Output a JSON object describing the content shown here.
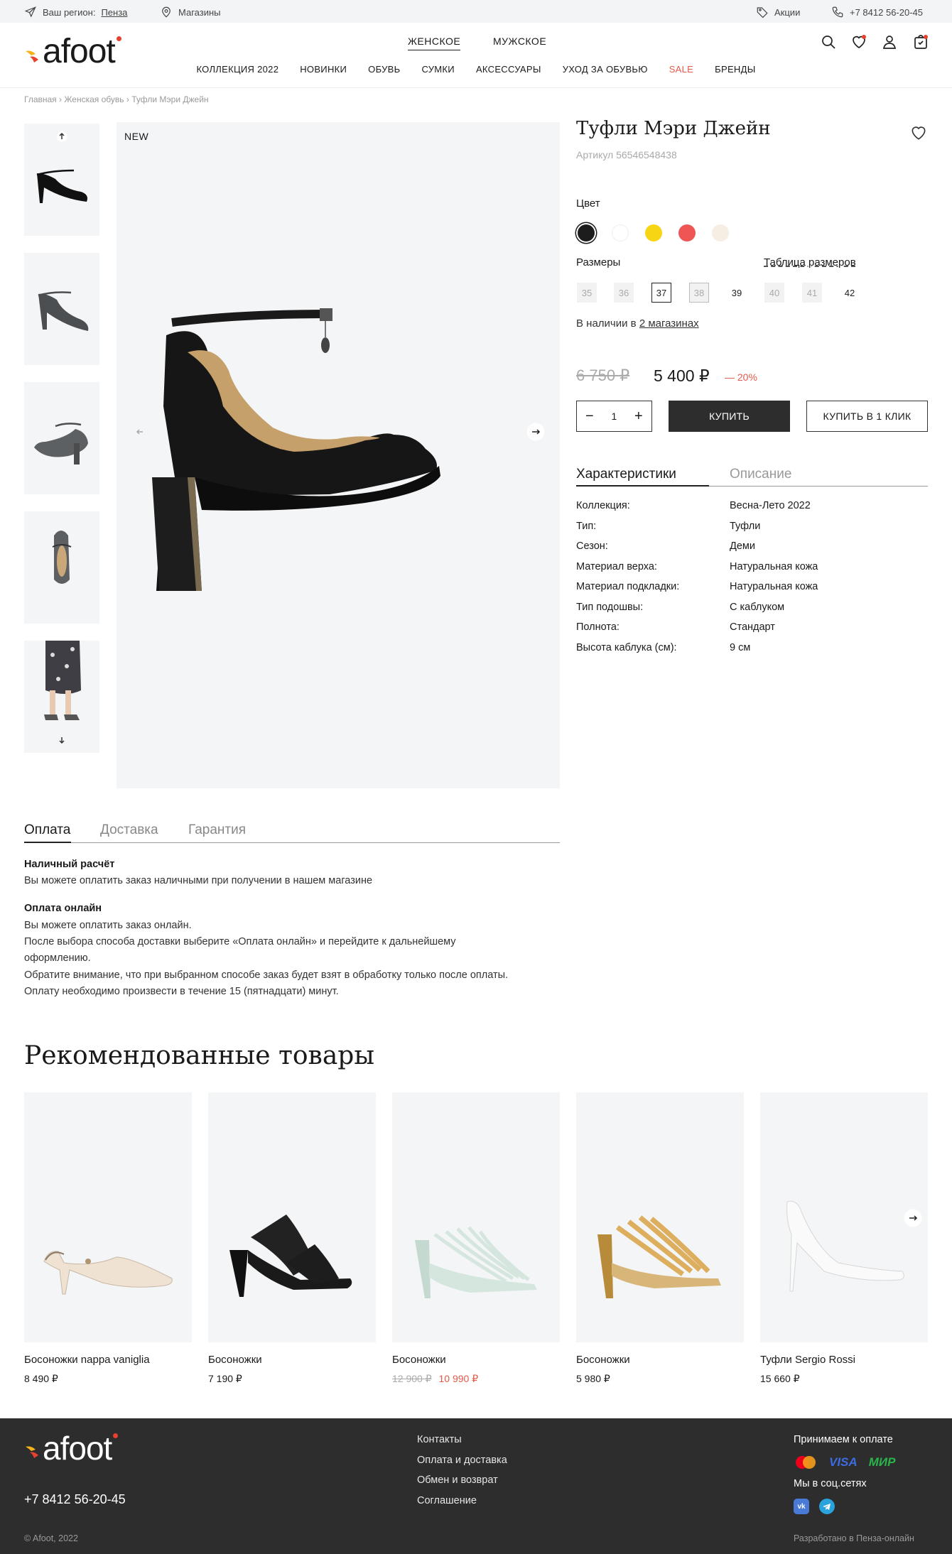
{
  "topbar": {
    "region_label": "Ваш регион:",
    "region_value": "Пенза",
    "stores": "Магазины",
    "promos": "Акции",
    "phone": "+7 8412 56-20-45"
  },
  "header": {
    "logo_text": "afoot",
    "genders": [
      "ЖЕНСКОЕ",
      "МУЖСКОЕ"
    ],
    "menu": [
      "КОЛЛЕКЦИЯ 2022",
      "НОВИНКИ",
      "ОБУВЬ",
      "СУМКИ",
      "АКСЕССУАРЫ",
      "УХОД ЗА ОБУВЬЮ",
      "SALE",
      "БРЕНДЫ"
    ],
    "sale_color": "#e35a4a"
  },
  "breadcrumbs": [
    "Главная",
    "Женская обувь",
    "Туфли Мэри Джейн"
  ],
  "gallery": {
    "badge": "NEW"
  },
  "product": {
    "title": "Туфли Мэри Джейн",
    "sku": "Артикул 56546548438",
    "color_label": "Цвет",
    "colors": [
      "#1d1d1d",
      "#ffffff",
      "#f7d514",
      "#f05555",
      "#f7eee3"
    ],
    "sizes_label": "Размеры",
    "size_table": "Таблица размеров",
    "sizes": [
      "35",
      "36",
      "37",
      "38",
      "39",
      "40",
      "41",
      "42"
    ],
    "availability_prefix": "В наличии в",
    "availability_link": "2 магазинах",
    "old_price": "6 750 ₽",
    "price": "5 400 ₽",
    "discount": "— 20%",
    "qty": "1",
    "buy": "КУПИТЬ",
    "buy_one_click": "КУПИТЬ В 1 КЛИК",
    "tabs": [
      "Характеристики",
      "Описание"
    ],
    "specs": [
      {
        "k": "Коллекция:",
        "v": "Весна-Лето 2022"
      },
      {
        "k": "Тип:",
        "v": "Туфли"
      },
      {
        "k": "Сезон:",
        "v": "Деми"
      },
      {
        "k": "Материал верха:",
        "v": "Натуральная кожа"
      },
      {
        "k": "Материал подкладки:",
        "v": "Натуральная кожа"
      },
      {
        "k": "Тип подошвы:",
        "v": "С каблуком"
      },
      {
        "k": "Полнота:",
        "v": "Стандарт"
      },
      {
        "k": "Высота каблука (см):",
        "v": "9 см"
      }
    ]
  },
  "payment": {
    "tabs": [
      "Оплата",
      "Доставка",
      "Гарантия"
    ],
    "cash_title": "Наличный расчёт",
    "cash_text": "Вы можете оплатить заказ наличными при получении в нашем магазине",
    "online_title": "Оплата онлайн",
    "online_lines": [
      "Вы можете оплатить заказ онлайн.",
      "После выбора способа доставки выберите «Оплата онлайн» и перейдите к дальнейшему",
      "оформлению.",
      "Обратите внимание, что при выбранном способе заказ будет взят в обработку только после оплаты.",
      "Оплату необходимо произвести в течение 15 (пятнадцати) минут."
    ]
  },
  "recommended": {
    "title": "Рекомендованные товары",
    "items": [
      {
        "name": "Босоножки nappa vaniglia",
        "price": "8 490 ₽",
        "old": ""
      },
      {
        "name": "Босоножки",
        "price": "7 190 ₽",
        "old": ""
      },
      {
        "name": "Босоножки",
        "price": "10 990 ₽",
        "old": "12 900 ₽"
      },
      {
        "name": "Босоножки",
        "price": "5 980 ₽",
        "old": ""
      },
      {
        "name": "Туфли Sergio Rossi",
        "price": "15 660 ₽",
        "old": ""
      }
    ]
  },
  "footer": {
    "phone": "+7 8412 56-20-45",
    "copyright": "© Afoot, 2022",
    "links": [
      "Контакты",
      "Оплата и доставка",
      "Обмен и возврат",
      "Соглашение"
    ],
    "payments_label": "Принимаем к оплате",
    "visa": "VISA",
    "mir": "МИР",
    "social_label": "Мы в соц.сетях",
    "vk": "vk",
    "dev": "Разработано в Пенза-онлайн"
  }
}
